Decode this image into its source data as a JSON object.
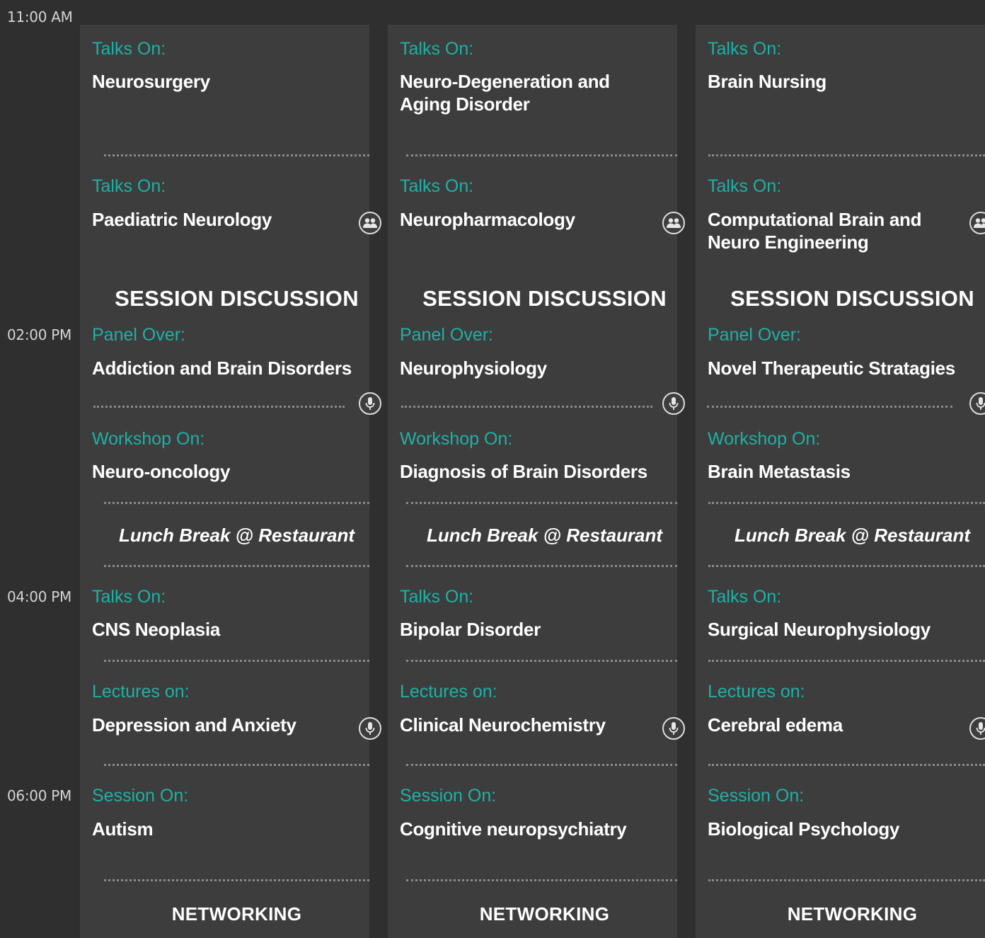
{
  "times": [
    "11:00 AM",
    "02:00 PM",
    "04:00 PM",
    "06:00 PM"
  ],
  "columns": [
    {
      "talk1_label": "Talks On:",
      "talk1_title": "Neurosurgery",
      "talk2_label": "Talks On:",
      "talk2_title": "Paediatric Neurology",
      "session": "SESSION DISCUSSION",
      "panel_label": "Panel Over:",
      "panel_title": "Addiction and Brain Disorders",
      "workshop_label": "Workshop On:",
      "workshop_title": "Neuro-oncology",
      "lunch": "Lunch Break @ Restaurant",
      "talk3_label": "Talks On:",
      "talk3_title": "CNS Neoplasia",
      "lecture_label": "Lectures on:",
      "lecture_title": "Depression and Anxiety",
      "session2_label": "Session On:",
      "session2_title": "Autism",
      "networking": "NETWORKING"
    },
    {
      "talk1_label": "Talks On:",
      "talk1_title": "Neuro-Degeneration and Aging Disorder",
      "talk2_label": "Talks On:",
      "talk2_title": "Neuropharmacology",
      "session": "SESSION DISCUSSION",
      "panel_label": "Panel Over:",
      "panel_title": "Neurophysiology",
      "workshop_label": "Workshop On:",
      "workshop_title": "Diagnosis of Brain Disorders",
      "lunch": "Lunch Break @ Restaurant",
      "talk3_label": "Talks On:",
      "talk3_title": "Bipolar Disorder",
      "lecture_label": "Lectures on:",
      "lecture_title": "Clinical Neurochemistry",
      "session2_label": "Session On:",
      "session2_title": "Cognitive neuropsychiatry",
      "networking": "NETWORKING"
    },
    {
      "talk1_label": "Talks On:",
      "talk1_title": "Brain Nursing",
      "talk2_label": "Talks On:",
      "talk2_title": "Computational Brain and Neuro Engineering",
      "session": "SESSION DISCUSSION",
      "panel_label": "Panel Over:",
      "panel_title": "Novel Therapeutic Stratagies",
      "workshop_label": "Workshop On:",
      "workshop_title": "Brain Metastasis",
      "lunch": "Lunch Break @ Restaurant",
      "talk3_label": "Talks On:",
      "talk3_title": "Surgical Neurophysiology",
      "lecture_label": "Lectures on:",
      "lecture_title": "Cerebral edema",
      "session2_label": "Session On:",
      "session2_title": "Biological Psychology",
      "networking": "NETWORKING"
    }
  ],
  "colors": {
    "page_bg": "#2f2f2f",
    "column_bg": "#3d3d3d",
    "accent_teal": "#1db1a6",
    "title_white": "#ffffff",
    "time_text": "#d4d4d4"
  },
  "icons": {
    "group": "group-icon",
    "microphone": "microphone-icon"
  }
}
